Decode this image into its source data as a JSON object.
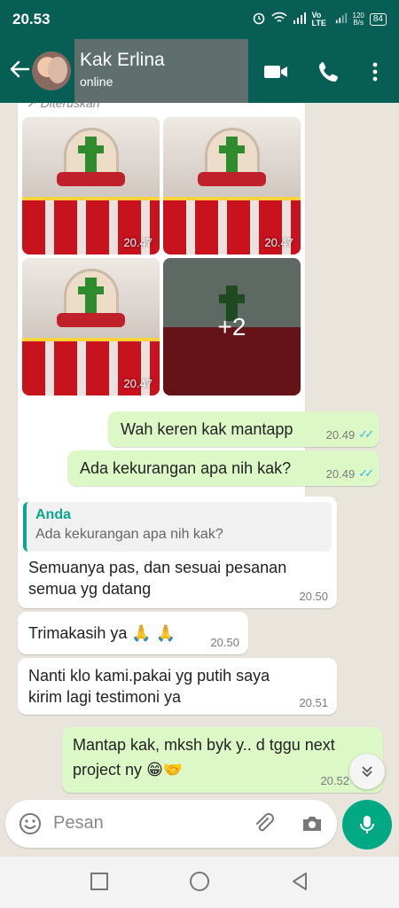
{
  "status_bar": {
    "time": "20.53",
    "network_label": "Vo LTE",
    "speed_value": "120",
    "speed_unit": "B/s",
    "battery": "84"
  },
  "header": {
    "contact_name": "Kak Erlina",
    "contact_status": "online",
    "color": "#075e54"
  },
  "gallery": {
    "forwarded_label": "Diteruskan",
    "photos": [
      {
        "time": "20.47"
      },
      {
        "time": "20.47"
      },
      {
        "time": "20.47"
      }
    ],
    "more_count": "+2"
  },
  "messages": [
    {
      "side": "out",
      "text": "Wah keren kak mantapp",
      "time": "20.49",
      "read": true
    },
    {
      "side": "out",
      "text": "Ada kekurangan apa nih kak?",
      "time": "20.49",
      "read": true
    },
    {
      "side": "in",
      "quote_author": "Anda",
      "quote_text": "Ada kekurangan apa nih kak?",
      "text_line1": "Semuanya pas, dan sesuai pesanan",
      "text_line2": "semua yg datang",
      "time": "20.50"
    },
    {
      "side": "in",
      "text": "Trimakasih ya",
      "emoji": "🙏 🙏",
      "time": "20.50"
    },
    {
      "side": "in",
      "text_line1": "Nanti klo kami.pakai yg putih saya",
      "text_line2": "kirim lagi testimoni ya",
      "time": "20.51"
    },
    {
      "side": "out",
      "text_line1": "Mantap kak, mksh byk y.. d tggu next",
      "text_line2": "project ny",
      "emoji": "😁🤝",
      "time": "20.52"
    }
  ],
  "input": {
    "placeholder": "Pesan"
  },
  "colors": {
    "outgoing_bubble": "#dcf8c6",
    "incoming_bubble": "#ffffff",
    "accent": "#00a884",
    "read_ticks": "#34b7f1"
  }
}
